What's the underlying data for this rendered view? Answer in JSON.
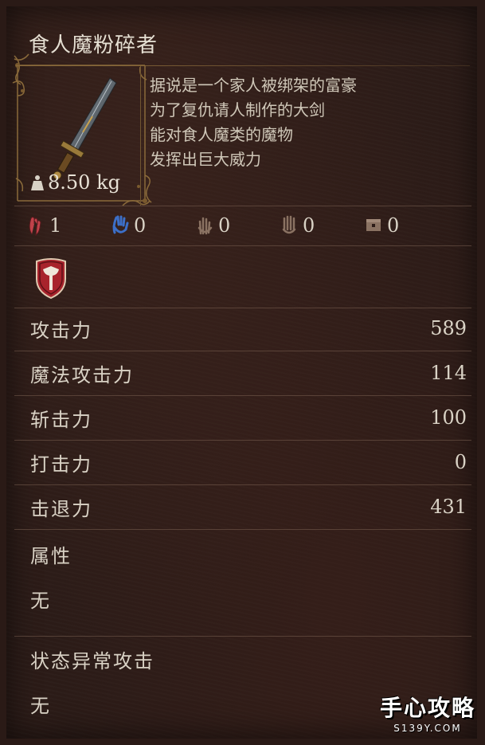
{
  "item": {
    "name": "食人魔粉碎者",
    "weight": "8.50 kg",
    "description": [
      "据说是一个家人被绑架的富豪",
      "为了复仇请人制作的大剑",
      "能对食人魔类的魔物",
      "发挥出巨大威力"
    ]
  },
  "requirements": [
    {
      "icon": "strength-hand-icon",
      "value": "1",
      "color": "#c0424a"
    },
    {
      "icon": "intellect-hand-icon",
      "value": "0",
      "color": "#3c6fc8"
    },
    {
      "icon": "dexterity-hand-icon",
      "value": "0",
      "color": "#8a7262"
    },
    {
      "icon": "faith-hand-icon",
      "value": "0",
      "color": "#8a7262"
    },
    {
      "icon": "chest-icon",
      "value": "0",
      "color": "#8a7262"
    }
  ],
  "emblem_icon": "axe-shield-emblem-icon",
  "stats": [
    {
      "label": "攻击力",
      "value": "589"
    },
    {
      "label": "魔法攻击力",
      "value": "114"
    },
    {
      "label": "斩击力",
      "value": "100"
    },
    {
      "label": "打击力",
      "value": "0"
    },
    {
      "label": "击退力",
      "value": "431"
    }
  ],
  "attribute": {
    "label": "属性",
    "value": "无"
  },
  "status_attack": {
    "label": "状态异常攻击",
    "value": "无"
  },
  "watermark": {
    "main": "手心攻略",
    "sub": "S139Y.COM"
  }
}
